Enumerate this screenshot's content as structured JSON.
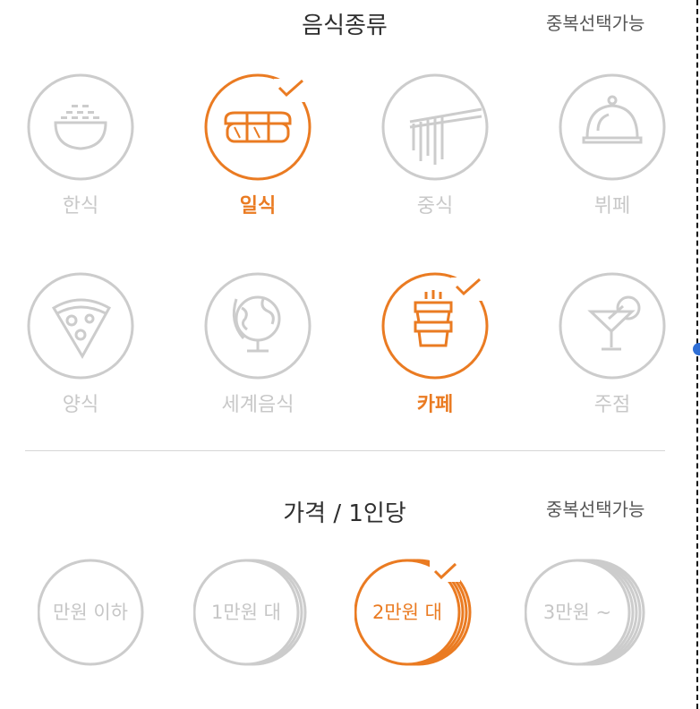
{
  "food_type": {
    "title": "음식종류",
    "multi_note": "중복선택가능",
    "items": [
      {
        "label": "한식",
        "icon": "rice-bowl-icon",
        "selected": false
      },
      {
        "label": "일식",
        "icon": "sushi-icon",
        "selected": true
      },
      {
        "label": "중식",
        "icon": "noodles-chopsticks-icon",
        "selected": false
      },
      {
        "label": "뷔페",
        "icon": "cloche-icon",
        "selected": false
      },
      {
        "label": "양식",
        "icon": "pizza-icon",
        "selected": false
      },
      {
        "label": "세계음식",
        "icon": "globe-icon",
        "selected": false
      },
      {
        "label": "카페",
        "icon": "coffee-cup-icon",
        "selected": true
      },
      {
        "label": "주점",
        "icon": "cocktail-icon",
        "selected": false
      }
    ]
  },
  "price": {
    "title": "가격 / 1인당",
    "multi_note": "중복선택가능",
    "items": [
      {
        "label": "만원 이하",
        "selected": false
      },
      {
        "label": "1만원 대",
        "selected": false
      },
      {
        "label": "2만원 대",
        "selected": true
      },
      {
        "label": "3만원 ~",
        "selected": false
      }
    ]
  },
  "colors": {
    "accent": "#ea7b22",
    "inactive": "#cccccc",
    "divider": "#d6d6d6"
  }
}
